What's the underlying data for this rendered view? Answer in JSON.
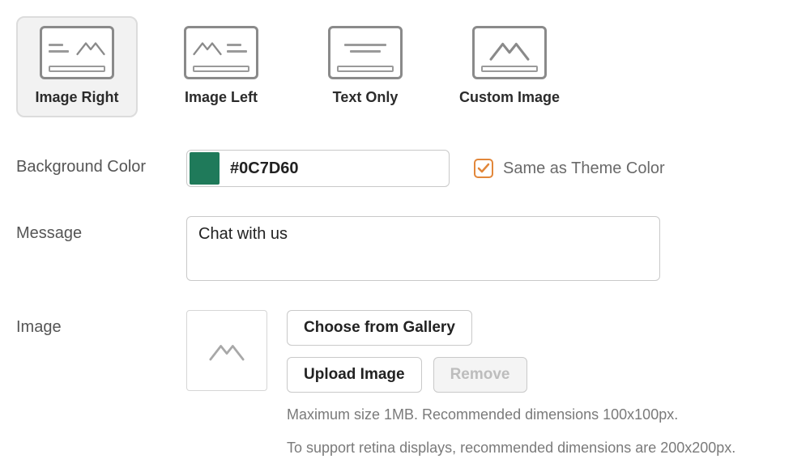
{
  "layout_options": [
    {
      "id": "image-right",
      "label": "Image Right",
      "selected": true
    },
    {
      "id": "image-left",
      "label": "Image Left",
      "selected": false
    },
    {
      "id": "text-only",
      "label": "Text Only",
      "selected": false
    },
    {
      "id": "custom-image",
      "label": "Custom Image",
      "selected": false
    }
  ],
  "background_color": {
    "label": "Background Color",
    "hex": "#0C7D60",
    "swatch": "#1f7a5a",
    "same_as_theme_checked": true,
    "same_as_theme_label": "Same as Theme Color",
    "accent_color": "#e2873a"
  },
  "message": {
    "label": "Message",
    "value": "Chat with us"
  },
  "image": {
    "label": "Image",
    "choose_gallery_label": "Choose from Gallery",
    "upload_label": "Upload Image",
    "remove_label": "Remove",
    "hint_line1": "Maximum size 1MB. Recommended dimensions 100x100px.",
    "hint_line2": "To support retina displays, recommended dimensions are 200x200px."
  }
}
